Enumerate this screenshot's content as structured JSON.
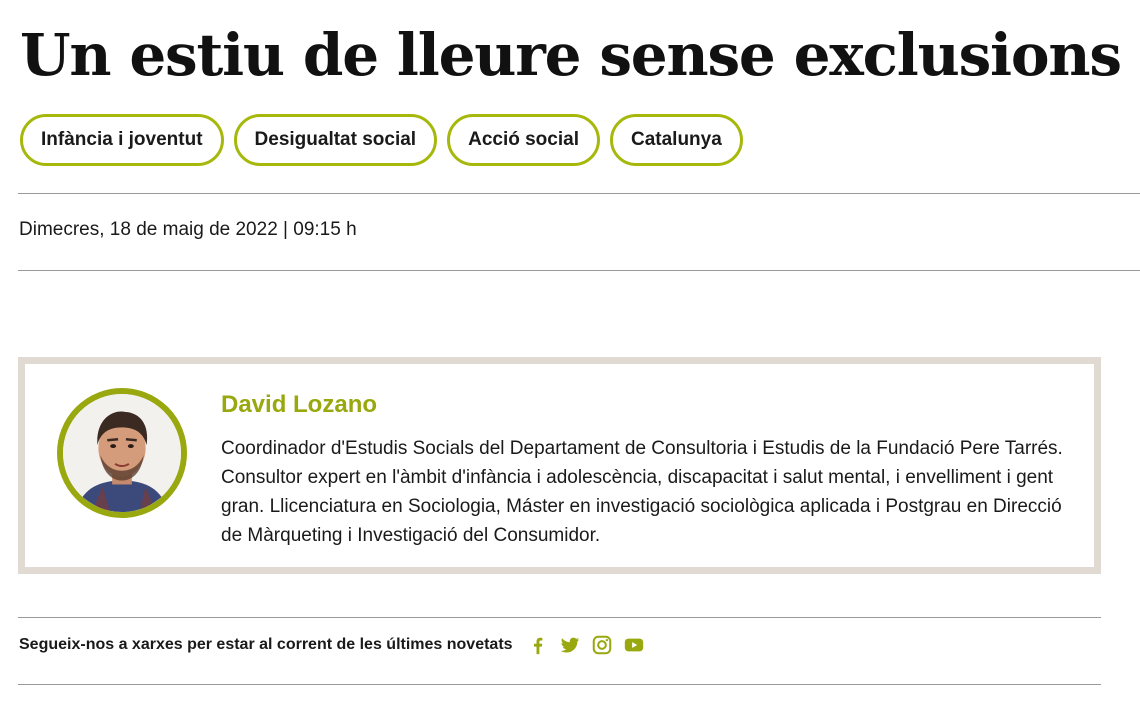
{
  "article": {
    "title": "Un estiu de lleure sense exclusions",
    "tags": [
      "Infància i joventut",
      "Desigualtat social",
      "Acció social",
      "Catalunya"
    ],
    "date": "Dimecres, 18 de maig de 2022 | 09:15 h"
  },
  "author": {
    "name": "David Lozano",
    "bio": "Coordinador d'Estudis Socials del Departament de Consultoria i Estudis de la Fundació Pere Tarrés. Consultor expert en l'àmbit d'infància i adolescència, discapacitat i salut mental, i envelliment i gent gran. Llicenciatura en Sociologia, Máster en investigació sociològica aplicada i Postgrau en Direcció de Màrqueting i Investigació del Consumidor."
  },
  "social": {
    "text": "Segueix-nos a xarxes per estar al corrent de les últimes novetats",
    "icons": [
      "facebook-icon",
      "twitter-icon",
      "instagram-icon",
      "youtube-icon"
    ]
  },
  "colors": {
    "accent": "#98a80e",
    "tag_border": "#a5b80b",
    "box_border": "#e0dad2"
  }
}
